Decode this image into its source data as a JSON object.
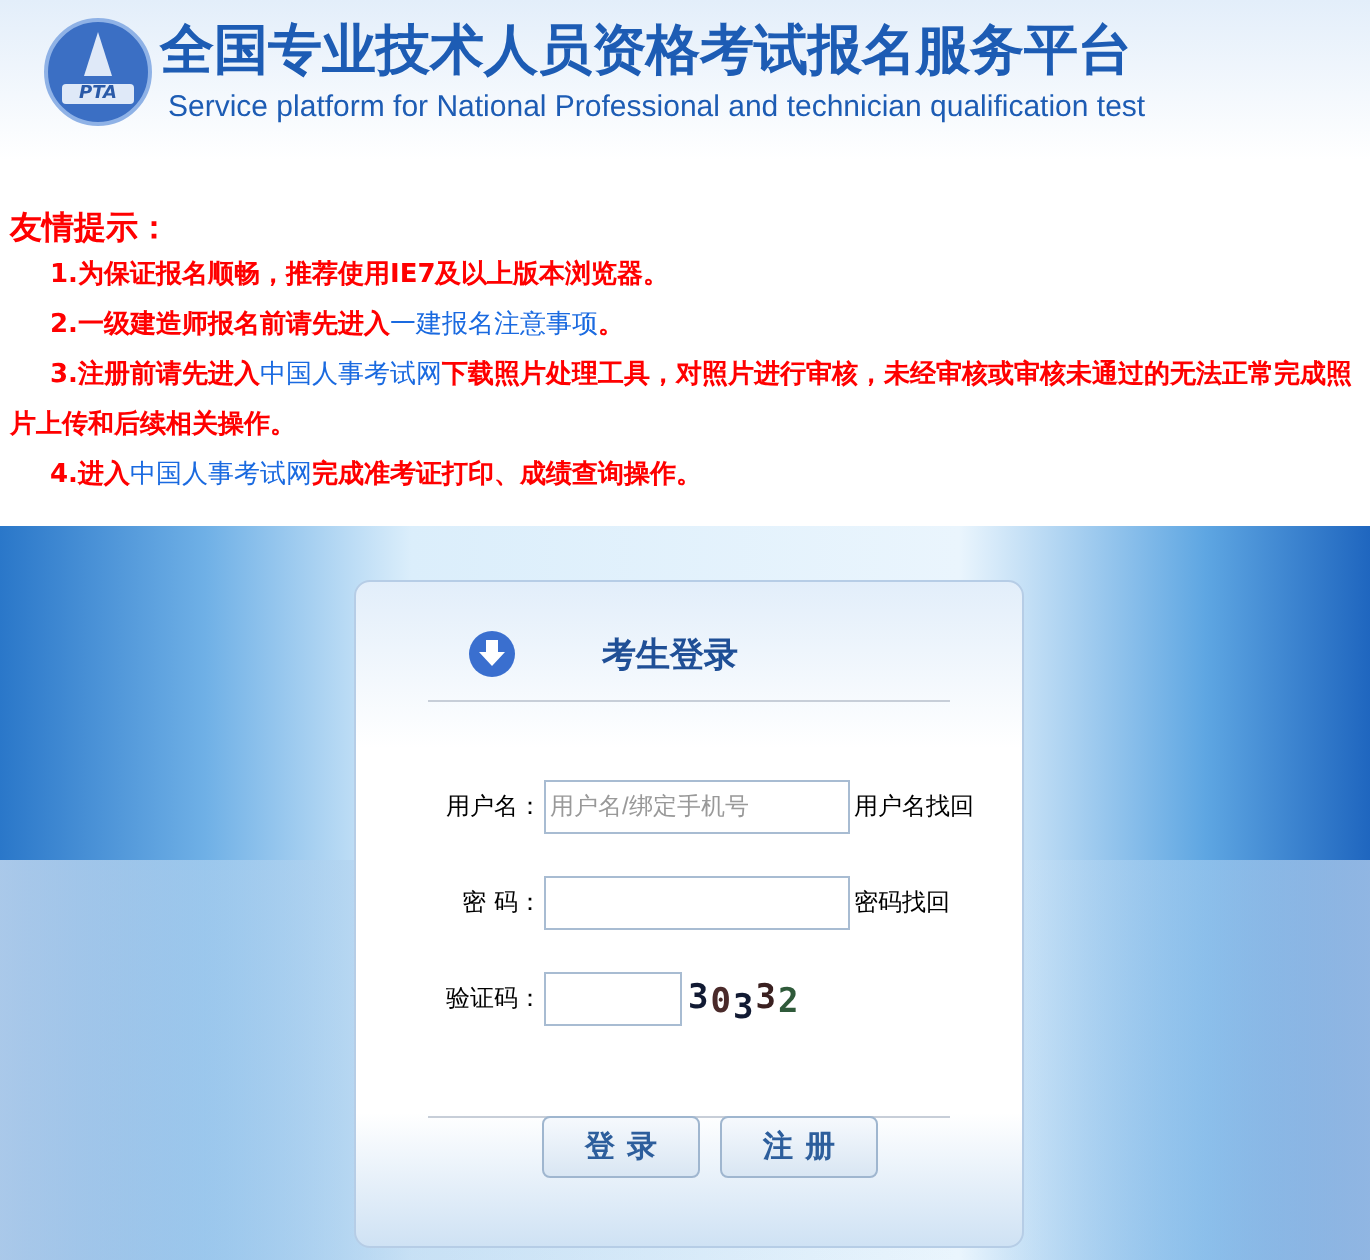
{
  "header": {
    "logo_text": "PTA",
    "title": "全国专业技术人员资格考试报名服务平台",
    "subtitle": "Service platform for National Professional and technician qualification test"
  },
  "tips": {
    "title": "友情提示：",
    "items": [
      {
        "segments": [
          {
            "text": "1.为保证报名顺畅，推荐使用IE7及以上版本浏览器。",
            "link": false
          }
        ]
      },
      {
        "segments": [
          {
            "text": "2.一级建造师报名前请先进入",
            "link": false
          },
          {
            "text": "一建报名注意事项",
            "link": true
          },
          {
            "text": "。",
            "link": false
          }
        ]
      },
      {
        "segments": [
          {
            "text": "3.注册前请先进入",
            "link": false
          },
          {
            "text": "中国人事考试网",
            "link": true
          },
          {
            "text": "下载照片处理工具，对照片进行审核，未经审核或审核未通过的无法正常完成照片上传和后续相关操作。",
            "link": false
          }
        ]
      },
      {
        "segments": [
          {
            "text": "4.进入",
            "link": false
          },
          {
            "text": "中国人事考试网",
            "link": true
          },
          {
            "text": "完成准考证打印、成绩查询操作。",
            "link": false
          }
        ]
      }
    ]
  },
  "login": {
    "title": "考生登录",
    "fields": [
      {
        "kind": "text",
        "label": "用户名：",
        "placeholder": "用户名/绑定手机号",
        "link": "用户名找回"
      },
      {
        "kind": "password",
        "label": "密 码：",
        "link": "密码找回"
      },
      {
        "kind": "captcha",
        "label": "验证码：",
        "captcha": "30332"
      }
    ],
    "buttons": [
      "登录",
      "注册"
    ]
  }
}
